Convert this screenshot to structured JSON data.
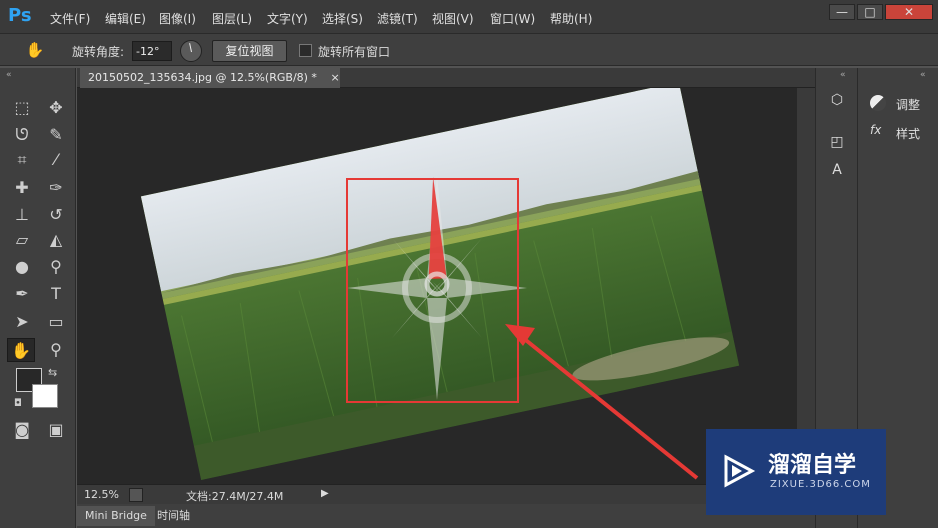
{
  "app": {
    "logo": "Ps",
    "menu": [
      "文件(F)",
      "编辑(E)",
      "图像(I)",
      "图层(L)",
      "文字(Y)",
      "选择(S)",
      "滤镜(T)",
      "视图(V)",
      "窗口(W)",
      "帮助(H)"
    ],
    "window_controls": {
      "minimize": "—",
      "maximize": "□",
      "close": "✕"
    }
  },
  "options": {
    "rotate_label": "旋转角度:",
    "rotate_value": "-12°",
    "reset_view": "复位视图",
    "rotate_all": "旋转所有窗口"
  },
  "document": {
    "tab_title": "20150502_135634.jpg @ 12.5%(RGB/8) *",
    "tab_close": "×",
    "rotation_deg": -12
  },
  "status": {
    "zoom": "12.5%",
    "doc_size": "文档:27.4M/27.4M",
    "arrow": "▶"
  },
  "bottom_tabs": [
    "Mini Bridge",
    "时间轴"
  ],
  "right_panel": {
    "items": [
      "调整",
      "样式"
    ]
  },
  "tools": [
    "rect-marquee-icon",
    "move-icon",
    "lasso-icon",
    "quick-select-icon",
    "crop-icon",
    "eyedropper-icon",
    "healing-icon",
    "brush-icon",
    "stamp-icon",
    "history-brush-icon",
    "eraser-icon",
    "bucket-icon",
    "blur-icon",
    "dodge-icon",
    "pen-icon",
    "type-icon",
    "path-select-icon",
    "shape-icon",
    "rotate-view-icon",
    "zoom-icon"
  ],
  "watermark": {
    "title": "溜溜自学",
    "url": "ZIXUE.3D66.COM"
  },
  "colors": {
    "accent": "#2fa3f2",
    "highlight_red": "#e53935",
    "watermark_bg": "#1e3c7a"
  }
}
